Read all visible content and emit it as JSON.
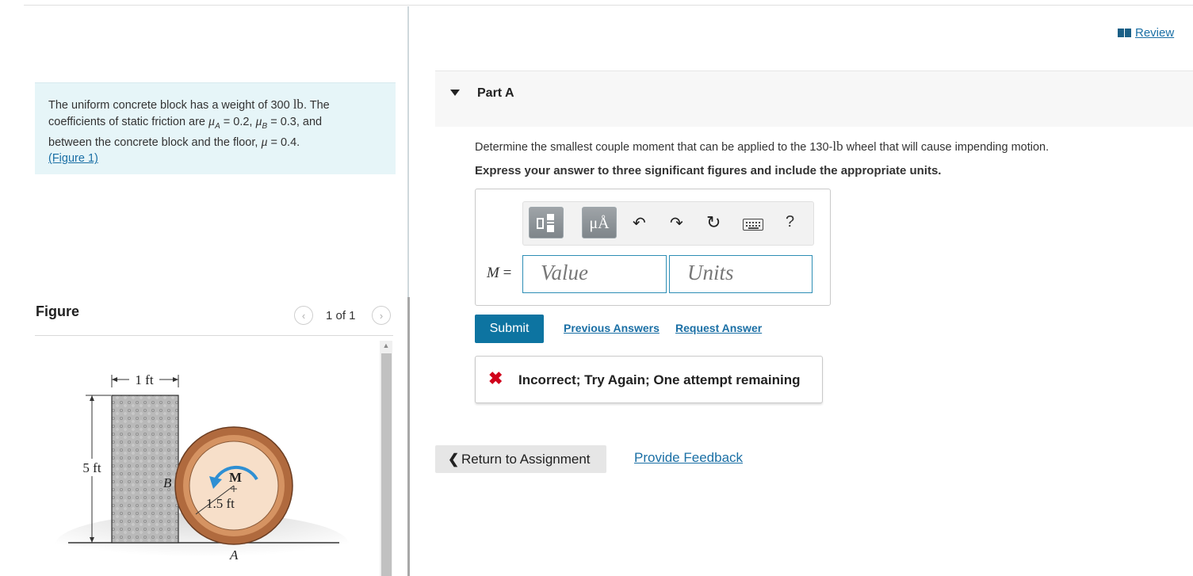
{
  "problem": {
    "text_1": "The uniform concrete block has a weight of 300 ",
    "unit_lb": "lb",
    "text_2": ". The coefficients of static friction are ",
    "mu": "μ",
    "sub_a": "A",
    "sub_b": "B",
    "eq_a": " = 0.2, ",
    "eq_b": " = 0.3, and between the concrete block and the floor, ",
    "eq_floor": " = 0.4.",
    "figure_link": "(Figure 1)"
  },
  "figure": {
    "title": "Figure",
    "pager_text": "1 of 1",
    "prev_glyph": "‹",
    "next_glyph": "›",
    "scroll_up_glyph": "▲",
    "labels": {
      "width": "1 ft",
      "height": "5 ft",
      "point_b": "B",
      "moment": "M",
      "radius": "1.5 ft",
      "point_a": "A"
    },
    "colors": {
      "block": "#b9b9b9",
      "wheel_rim": "#b06a3e",
      "wheel_inner": "#f7dfc9",
      "moment_arrow": "#2e8fd3"
    }
  },
  "header": {
    "review_label": "Review",
    "review_icon": "book-icon"
  },
  "part": {
    "title": "Part A",
    "question_1": "Determine the smallest couple moment that can be applied to the 130-",
    "question_unit": "lb",
    "question_2": " wheel that will cause impending motion.",
    "instruction": "Express your answer to three significant figures and include the appropriate units."
  },
  "toolbar": {
    "templates_icon": "templates-icon",
    "units_label": "μÅ",
    "undo_glyph": "↶",
    "redo_glyph": "↷",
    "reset_glyph": "↻",
    "help_glyph": "?"
  },
  "answer": {
    "variable": "M",
    "equals": " =",
    "value_placeholder": "Value",
    "units_placeholder": "Units"
  },
  "actions": {
    "submit": "Submit",
    "previous_answers": "Previous Answers",
    "request_answer": "Request Answer"
  },
  "feedback": {
    "icon_glyph": "✖",
    "text": "Incorrect; Try Again; One attempt remaining",
    "icon_color": "#d0021b"
  },
  "footer": {
    "return_glyph": "❮",
    "return_label": "Return to Assignment",
    "provide_feedback": "Provide Feedback"
  },
  "colors": {
    "accent": "#0d74a1",
    "link": "#1a6fa5",
    "problem_bg": "#e6f5f8"
  }
}
